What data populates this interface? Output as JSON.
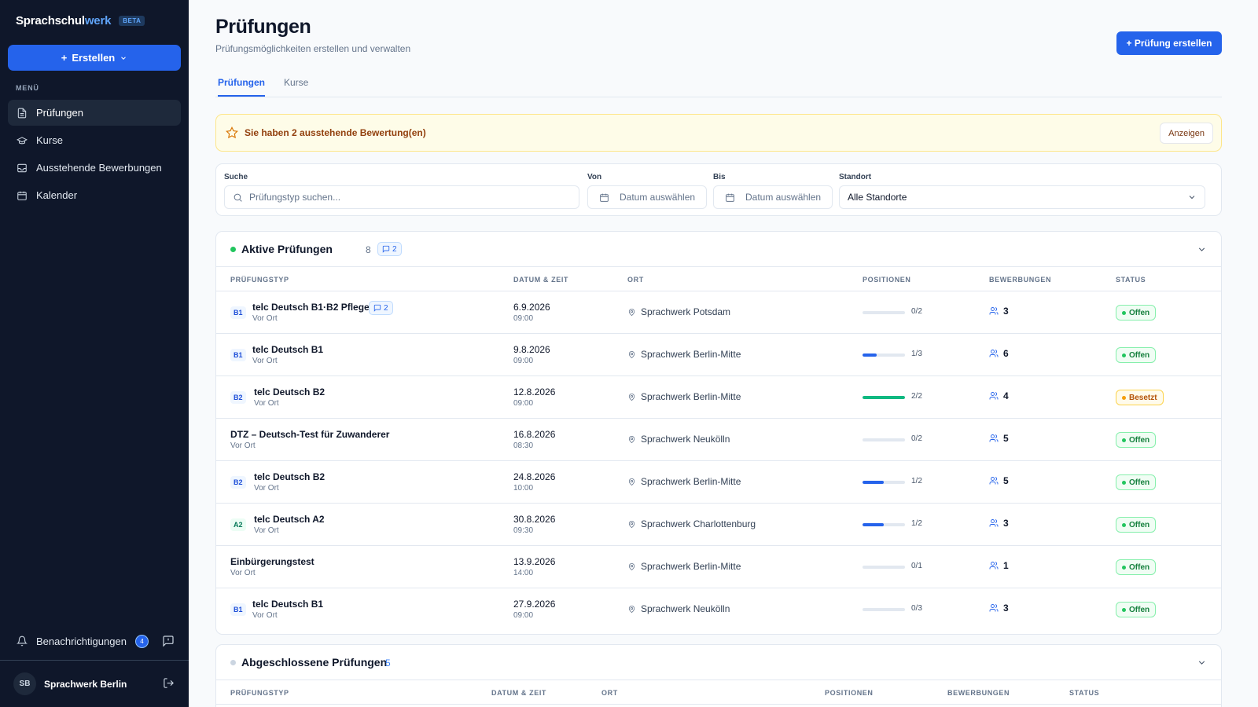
{
  "brand": {
    "name_main": "Sprachschul",
    "name_accent": "werk",
    "badge": "BETA"
  },
  "sidebar": {
    "create_label": "Erstellen",
    "menu_heading": "MENÜ",
    "items": [
      {
        "label": "Prüfungen",
        "icon": "document-icon",
        "active": true
      },
      {
        "label": "Kurse",
        "icon": "graduation-cap-icon",
        "active": false
      },
      {
        "label": "Ausstehende Bewerbungen",
        "icon": "inbox-icon",
        "active": false
      },
      {
        "label": "Kalender",
        "icon": "calendar-icon",
        "active": false
      }
    ],
    "notifications_label": "Benachrichtigungen",
    "notifications_count": "4",
    "user_initials": "SB",
    "user_name": "Sprachwerk Berlin"
  },
  "header": {
    "title": "Prüfungen",
    "subtitle": "Prüfungsmöglichkeiten erstellen und verwalten",
    "create_button": "+ Prüfung erstellen"
  },
  "tabs": [
    "Prüfungen",
    "Kurse"
  ],
  "alert": {
    "text": "Sie haben 2 ausstehende Bewertung(en)",
    "button": "Anzeigen"
  },
  "filters": {
    "search_label": "Suche",
    "search_placeholder": "Prüfungstyp suchen...",
    "from_label": "Von",
    "from_placeholder": "Datum auswählen",
    "to_label": "Bis",
    "to_placeholder": "Datum auswählen",
    "location_label": "Standort",
    "location_value": "Alle Standorte"
  },
  "columns": [
    "PRÜFUNGSTYP",
    "DATUM & ZEIT",
    "ORT",
    "POSITIONEN",
    "BEWERBUNGEN",
    "STATUS"
  ],
  "active": {
    "title": "Aktive Prüfungen",
    "count": "8",
    "messages": "2",
    "rows": [
      {
        "level": "B1",
        "name": "telc Deutsch B1·B2 Pflege",
        "messages": "2",
        "mode": "Vor Ort",
        "date": "6.9.2026",
        "time": "09:00",
        "location": "Sprachwerk Potsdam",
        "filled": 0,
        "total": 2,
        "positions": "0/2",
        "applications": "3",
        "status": "Offen"
      },
      {
        "level": "B1",
        "name": "telc Deutsch B1",
        "messages": "",
        "mode": "Vor Ort",
        "date": "9.8.2026",
        "time": "09:00",
        "location": "Sprachwerk Berlin-Mitte",
        "filled": 1,
        "total": 3,
        "positions": "1/3",
        "applications": "6",
        "status": "Offen"
      },
      {
        "level": "B2",
        "name": "telc Deutsch B2",
        "messages": "",
        "mode": "Vor Ort",
        "date": "12.8.2026",
        "time": "09:00",
        "location": "Sprachwerk Berlin-Mitte",
        "filled": 2,
        "total": 2,
        "positions": "2/2",
        "applications": "4",
        "status": "Besetzt"
      },
      {
        "level": "",
        "name": "DTZ – Deutsch-Test für Zuwanderer",
        "messages": "",
        "mode": "Vor Ort",
        "date": "16.8.2026",
        "time": "08:30",
        "location": "Sprachwerk Neukölln",
        "filled": 0,
        "total": 2,
        "positions": "0/2",
        "applications": "5",
        "status": "Offen"
      },
      {
        "level": "B2",
        "name": "telc Deutsch B2",
        "messages": "",
        "mode": "Vor Ort",
        "date": "24.8.2026",
        "time": "10:00",
        "location": "Sprachwerk Berlin-Mitte",
        "filled": 1,
        "total": 2,
        "positions": "1/2",
        "applications": "5",
        "status": "Offen"
      },
      {
        "level": "A2",
        "name": "telc Deutsch A2",
        "messages": "",
        "mode": "Vor Ort",
        "date": "30.8.2026",
        "time": "09:30",
        "location": "Sprachwerk Charlottenburg",
        "filled": 1,
        "total": 2,
        "positions": "1/2",
        "applications": "3",
        "status": "Offen"
      },
      {
        "level": "",
        "name": "Einbürgerungstest",
        "messages": "",
        "mode": "Vor Ort",
        "date": "13.9.2026",
        "time": "14:00",
        "location": "Sprachwerk Berlin-Mitte",
        "filled": 0,
        "total": 1,
        "positions": "0/1",
        "applications": "1",
        "status": "Offen"
      },
      {
        "level": "B1",
        "name": "telc Deutsch B1",
        "messages": "",
        "mode": "Vor Ort",
        "date": "27.9.2026",
        "time": "09:00",
        "location": "Sprachwerk Neukölln",
        "filled": 0,
        "total": 3,
        "positions": "0/3",
        "applications": "3",
        "status": "Offen"
      }
    ]
  },
  "completed": {
    "title": "Abgeschlossene Prüfungen",
    "count": "5"
  },
  "colors": {
    "accent": "#2563eb",
    "open": "#22c55e",
    "full": "#f59e0b",
    "sidebar": "#0f172a"
  }
}
